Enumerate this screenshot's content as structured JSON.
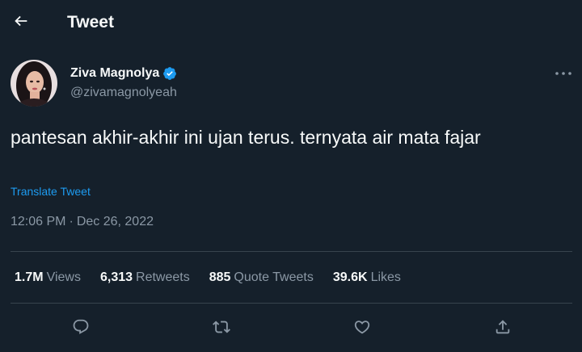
{
  "header": {
    "title": "Tweet"
  },
  "author": {
    "display_name": "Ziva Magnolya",
    "handle": "@zivamagnolyeah",
    "verified": true
  },
  "tweet": {
    "text": "pantesan akhir-akhir ini ujan terus. ternyata air mata fajar",
    "translate_label": "Translate Tweet",
    "time": "12:06 PM",
    "separator": "·",
    "date": "Dec 26, 2022"
  },
  "stats": [
    {
      "value": "1.7M",
      "label": "Views"
    },
    {
      "value": "6,313",
      "label": "Retweets"
    },
    {
      "value": "885",
      "label": "Quote Tweets"
    },
    {
      "value": "39.6K",
      "label": "Likes"
    }
  ],
  "actions": [
    "reply-icon",
    "retweet-icon",
    "like-icon",
    "share-icon"
  ],
  "colors": {
    "background": "#15202b",
    "text": "#f7f9f9",
    "secondary": "#8b98a5",
    "accent": "#1d9bf0",
    "divider": "#38444d"
  }
}
